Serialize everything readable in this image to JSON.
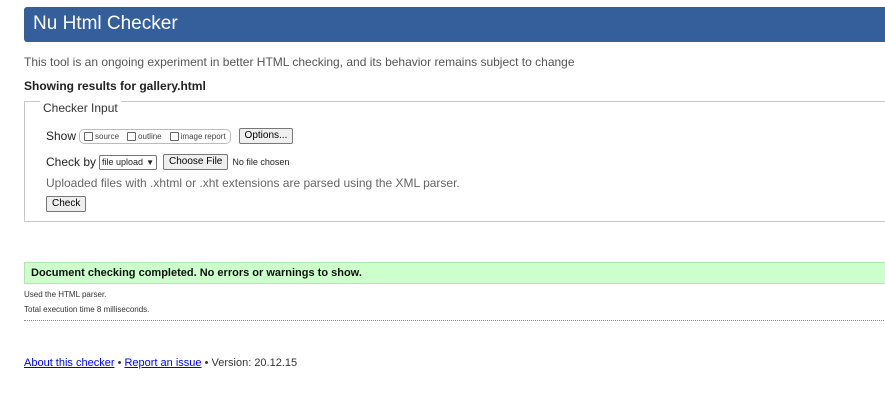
{
  "header": {
    "title": "Nu Html Checker"
  },
  "intro": "This tool is an ongoing experiment in better HTML checking, and its behavior remains subject to change",
  "showing_results": "Showing results for gallery.html",
  "checker_input": {
    "legend": "Checker Input",
    "show_label": "Show",
    "options": [
      {
        "label": "source",
        "checked": false
      },
      {
        "label": "outline",
        "checked": false
      },
      {
        "label": "image report",
        "checked": false
      }
    ],
    "options_button": "Options...",
    "check_by_label": "Check by",
    "check_by_value": "file upload",
    "choose_file_button": "Choose File",
    "no_file_text": "No file chosen",
    "note": "Uploaded files with .xhtml or .xht extensions are parsed using the XML parser.",
    "check_button": "Check"
  },
  "result": {
    "message": "Document checking completed. No errors or warnings to show.",
    "parser": "Used the HTML parser.",
    "time": "Total execution time 8 milliseconds."
  },
  "footer": {
    "about_link": "About this checker",
    "separator": "•",
    "report_link": "Report an issue",
    "version_text": "Version: 20.12.15"
  },
  "colors": {
    "banner": "#355f9b",
    "success_bg": "#ccffcc",
    "link": "#0000ee"
  }
}
